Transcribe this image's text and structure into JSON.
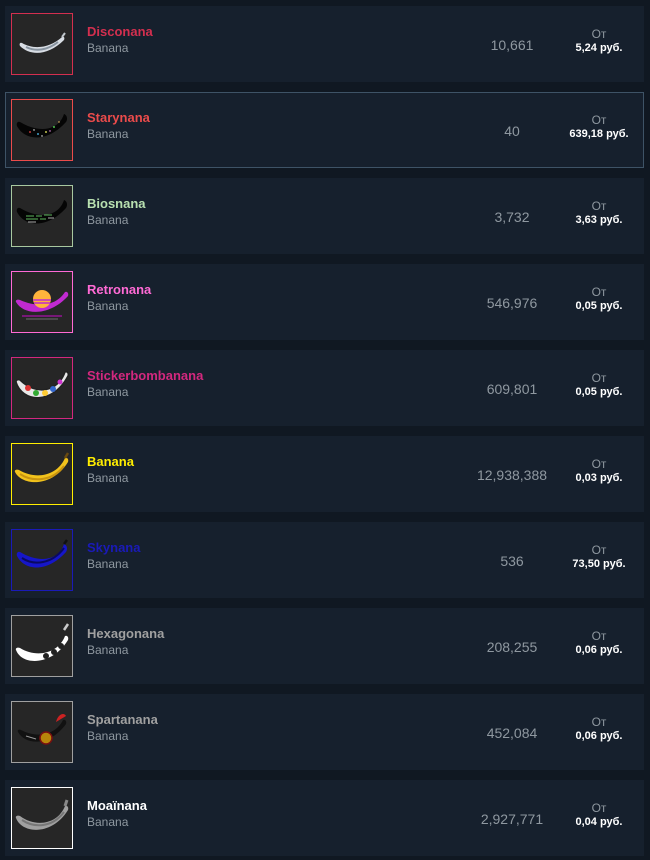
{
  "listings": [
    {
      "name": "Disconana",
      "game": "Banana",
      "quantity": "10,661",
      "from_label": "От",
      "price": "5,24 руб.",
      "name_color": "#d32f4f",
      "border_color": "#d32f4f",
      "icon": "disco-banana-icon",
      "selected": false
    },
    {
      "name": "Starynana",
      "game": "Banana",
      "quantity": "40",
      "from_label": "От",
      "price": "639,18 руб.",
      "name_color": "#eb4b4b",
      "border_color": "#eb4b4b",
      "icon": "starry-banana-icon",
      "selected": true
    },
    {
      "name": "Biosnana",
      "game": "Banana",
      "quantity": "3,732",
      "from_label": "От",
      "price": "3,63 руб.",
      "name_color": "#b8e0b0",
      "border_color": "#a8c8a0",
      "icon": "bios-banana-icon",
      "selected": false
    },
    {
      "name": "Retronana",
      "game": "Banana",
      "quantity": "546,976",
      "from_label": "От",
      "price": "0,05 руб.",
      "name_color": "#ff6ad5",
      "border_color": "#ff6ad5",
      "icon": "retro-banana-icon",
      "selected": false
    },
    {
      "name": "Stickerbombanana",
      "game": "Banana",
      "quantity": "609,801",
      "from_label": "От",
      "price": "0,05 руб.",
      "name_color": "#d3287e",
      "border_color": "#d3287e",
      "icon": "sticker-banana-icon",
      "selected": false
    },
    {
      "name": "Banana",
      "game": "Banana",
      "quantity": "12,938,388",
      "from_label": "От",
      "price": "0,03 руб.",
      "name_color": "#ffee00",
      "border_color": "#ffee00",
      "icon": "yellow-banana-icon",
      "selected": false
    },
    {
      "name": "Skynana",
      "game": "Banana",
      "quantity": "536",
      "from_label": "От",
      "price": "73,50 руб.",
      "name_color": "#1a1ab8",
      "border_color": "#1a1ab8",
      "icon": "sky-banana-icon",
      "selected": false
    },
    {
      "name": "Hexagonana",
      "game": "Banana",
      "quantity": "208,255",
      "from_label": "От",
      "price": "0,06 руб.",
      "name_color": "#a0a0a0",
      "border_color": "#a0a0a0",
      "icon": "hexagon-banana-icon",
      "selected": false
    },
    {
      "name": "Spartanana",
      "game": "Banana",
      "quantity": "452,084",
      "from_label": "От",
      "price": "0,06 руб.",
      "name_color": "#a0a0a0",
      "border_color": "#a0a0a0",
      "icon": "spartan-banana-icon",
      "selected": false
    },
    {
      "name": "Moaïnana",
      "game": "Banana",
      "quantity": "2,927,771",
      "from_label": "От",
      "price": "0,04 руб.",
      "name_color": "#ffffff",
      "border_color": "#ffffff",
      "icon": "moai-banana-icon",
      "selected": false
    }
  ]
}
